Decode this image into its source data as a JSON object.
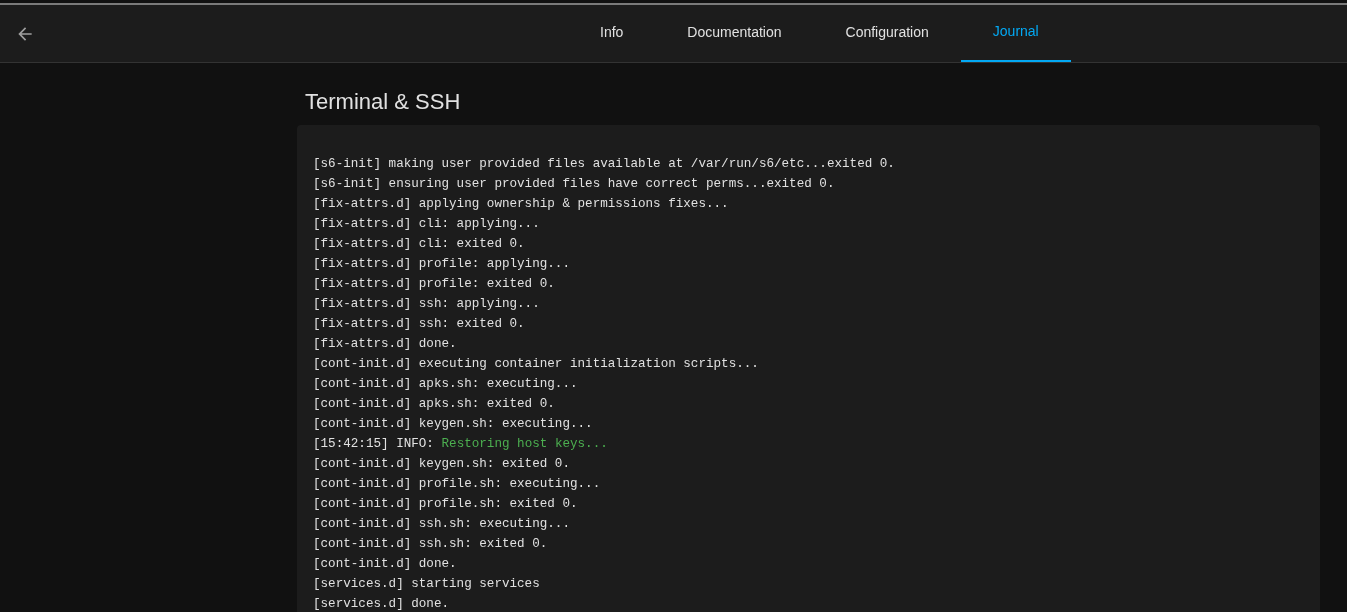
{
  "tabs": [
    {
      "label": "Info",
      "selected": false
    },
    {
      "label": "Documentation",
      "selected": false
    },
    {
      "label": "Configuration",
      "selected": false
    },
    {
      "label": "Journal",
      "selected": true
    }
  ],
  "title": "Terminal & SSH",
  "log": [
    {
      "kind": "plain",
      "text": "[s6-init] making user provided files available at /var/run/s6/etc...exited 0."
    },
    {
      "kind": "plain",
      "text": "[s6-init] ensuring user provided files have correct perms...exited 0."
    },
    {
      "kind": "plain",
      "text": "[fix-attrs.d] applying ownership & permissions fixes..."
    },
    {
      "kind": "plain",
      "text": "[fix-attrs.d] cli: applying..."
    },
    {
      "kind": "plain",
      "text": "[fix-attrs.d] cli: exited 0."
    },
    {
      "kind": "plain",
      "text": "[fix-attrs.d] profile: applying..."
    },
    {
      "kind": "plain",
      "text": "[fix-attrs.d] profile: exited 0."
    },
    {
      "kind": "plain",
      "text": "[fix-attrs.d] ssh: applying..."
    },
    {
      "kind": "plain",
      "text": "[fix-attrs.d] ssh: exited 0."
    },
    {
      "kind": "plain",
      "text": "[fix-attrs.d] done."
    },
    {
      "kind": "plain",
      "text": "[cont-init.d] executing container initialization scripts..."
    },
    {
      "kind": "plain",
      "text": "[cont-init.d] apks.sh: executing..."
    },
    {
      "kind": "plain",
      "text": "[cont-init.d] apks.sh: exited 0."
    },
    {
      "kind": "plain",
      "text": "[cont-init.d] keygen.sh: executing..."
    },
    {
      "kind": "info",
      "text": "[15:42:15] INFO:",
      "message": "Restoring host keys..."
    },
    {
      "kind": "plain",
      "text": "[cont-init.d] keygen.sh: exited 0."
    },
    {
      "kind": "plain",
      "text": "[cont-init.d] profile.sh: executing..."
    },
    {
      "kind": "plain",
      "text": "[cont-init.d] profile.sh: exited 0."
    },
    {
      "kind": "plain",
      "text": "[cont-init.d] ssh.sh: executing..."
    },
    {
      "kind": "plain",
      "text": "[cont-init.d] ssh.sh: exited 0."
    },
    {
      "kind": "plain",
      "text": "[cont-init.d] done."
    },
    {
      "kind": "plain",
      "text": "[services.d] starting services"
    },
    {
      "kind": "plain",
      "text": "[services.d] done."
    }
  ]
}
